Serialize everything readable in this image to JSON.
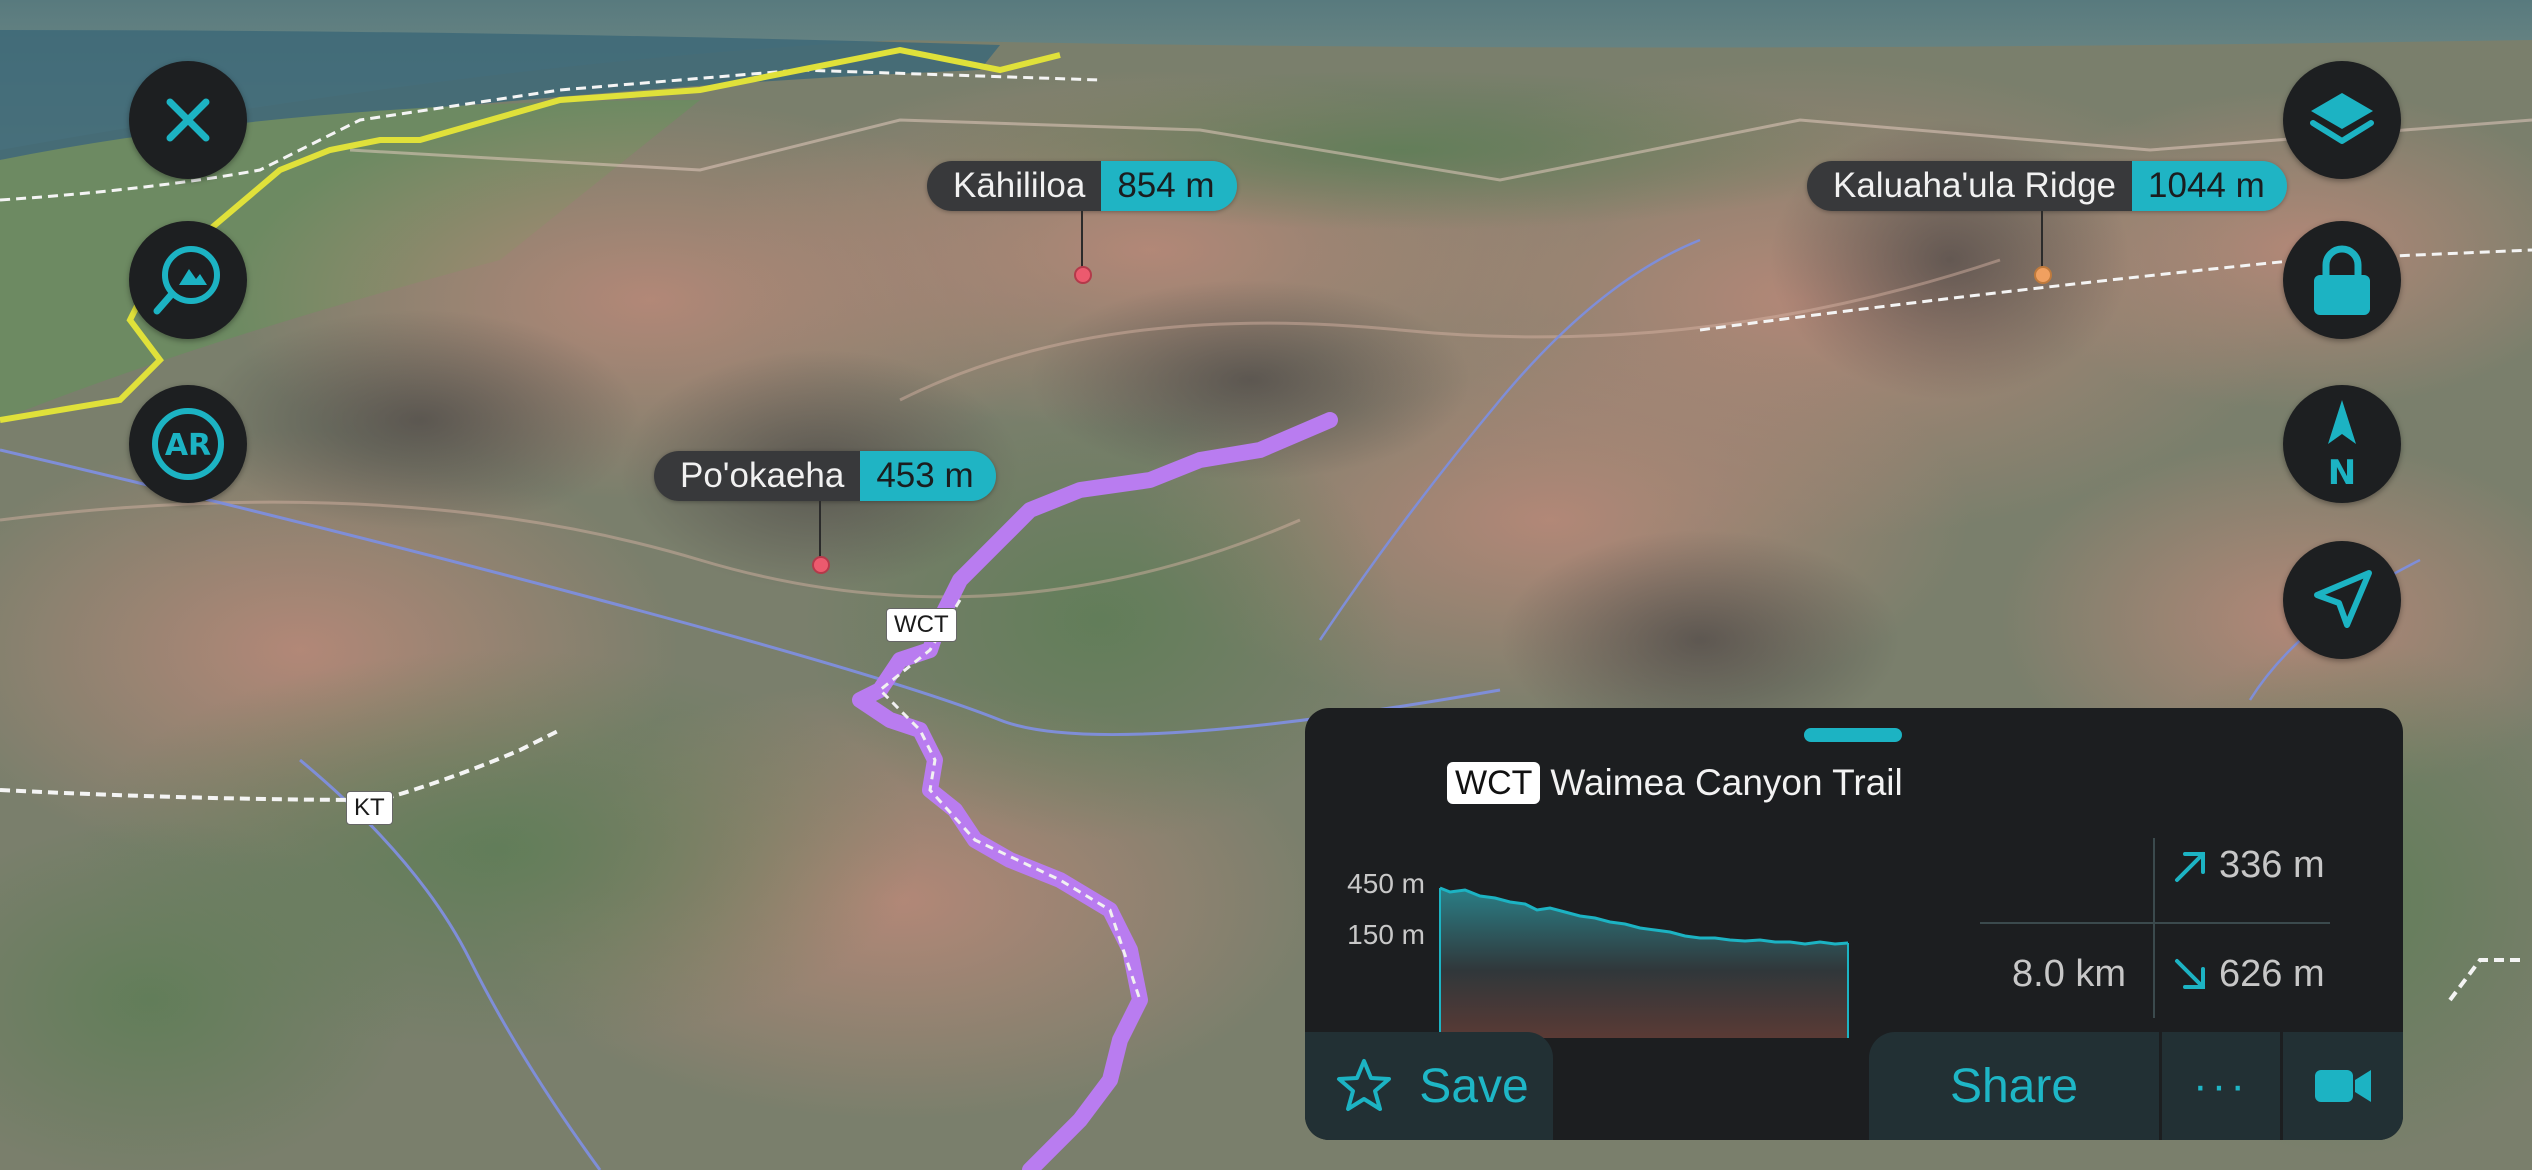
{
  "map": {
    "peaks": [
      {
        "name": "Kāhililoa",
        "altitude": "854 m"
      },
      {
        "name": "Kaluaha'ula Ridge",
        "altitude": "1044 m"
      },
      {
        "name": "Po'okaeha",
        "altitude": "453 m"
      }
    ],
    "trail_tags": [
      "WCT",
      "KT"
    ]
  },
  "controls": {
    "left": [
      {
        "id": "close",
        "icon": "close-icon"
      },
      {
        "id": "search-peaks",
        "icon": "mountain-search-icon"
      },
      {
        "id": "ar",
        "icon": "ar-icon",
        "label": "AR"
      }
    ],
    "right": [
      {
        "id": "layers",
        "icon": "layers-icon"
      },
      {
        "id": "lock",
        "icon": "lock-icon"
      },
      {
        "id": "compass",
        "icon": "north-compass-icon",
        "label": "N"
      },
      {
        "id": "locate",
        "icon": "location-arrow-icon"
      }
    ]
  },
  "trail_panel": {
    "tag": "WCT",
    "name": "Waimea Canyon Trail",
    "elevation_axis": [
      "450 m",
      "150 m"
    ],
    "distance": "8.0 km",
    "ascent": "336 m",
    "descent": "626 m",
    "buttons": {
      "save": "Save",
      "share": "Share",
      "more": "···"
    }
  },
  "colors": {
    "accent": "#1fb4c4",
    "trail": "#b97cf0",
    "button_bg": "#1d1f21",
    "panel_bg": "#1c1e20"
  }
}
